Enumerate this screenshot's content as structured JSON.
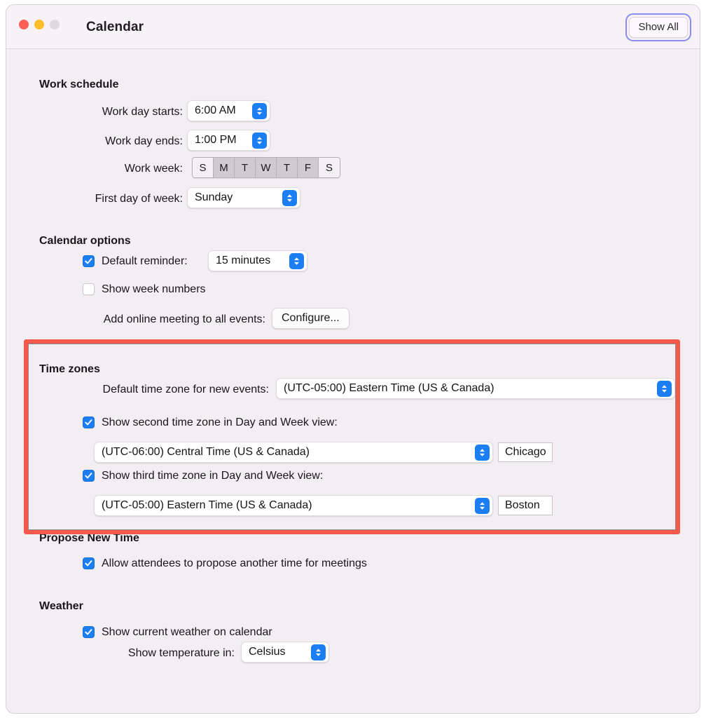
{
  "window": {
    "title": "Calendar",
    "traffic_lights": [
      "close-red",
      "minimize-yellow",
      "zoom-disabled-gray"
    ],
    "show_all_label": "Show All"
  },
  "sections": {
    "work_schedule": {
      "title": "Work schedule",
      "work_day_starts_label": "Work day starts:",
      "work_day_starts_value": "6:00 AM",
      "work_day_ends_label": "Work day ends:",
      "work_day_ends_value": "1:00 PM",
      "work_week_label": "Work week:",
      "work_week_days": [
        {
          "label": "S",
          "selected": false
        },
        {
          "label": "M",
          "selected": true
        },
        {
          "label": "T",
          "selected": true
        },
        {
          "label": "W",
          "selected": true
        },
        {
          "label": "T",
          "selected": true
        },
        {
          "label": "F",
          "selected": true
        },
        {
          "label": "S",
          "selected": false
        }
      ],
      "first_day_label": "First day of week:",
      "first_day_value": "Sunday"
    },
    "calendar_options": {
      "title": "Calendar options",
      "default_reminder_label": "Default reminder:",
      "default_reminder_checked": true,
      "default_reminder_value": "15 minutes",
      "show_week_numbers_label": "Show week numbers",
      "show_week_numbers_checked": false,
      "add_online_meeting_label": "Add online meeting to all events:",
      "configure_button_label": "Configure..."
    },
    "time_zones": {
      "title": "Time zones",
      "highlighted": true,
      "highlight_color": "#f6584a",
      "default_tz_label": "Default time zone for new events:",
      "default_tz_value": "(UTC-05:00) Eastern Time (US & Canada)",
      "second_tz_checkbox_label": "Show second time zone in Day and Week view:",
      "second_tz_checked": true,
      "second_tz_value": "(UTC-06:00) Central Time (US & Canada)",
      "second_tz_city": "Chicago",
      "third_tz_checkbox_label": "Show third time zone in Day and Week view:",
      "third_tz_checked": true,
      "third_tz_value": "(UTC-05:00) Eastern Time (US & Canada)",
      "third_tz_city": "Boston"
    },
    "propose_new_time": {
      "title": "Propose New Time",
      "allow_label": "Allow attendees to propose another time for meetings",
      "allow_checked": true
    },
    "weather": {
      "title": "Weather",
      "show_weather_label": "Show current weather on calendar",
      "show_weather_checked": true,
      "temperature_label": "Show temperature in:",
      "temperature_value": "Celsius"
    }
  }
}
